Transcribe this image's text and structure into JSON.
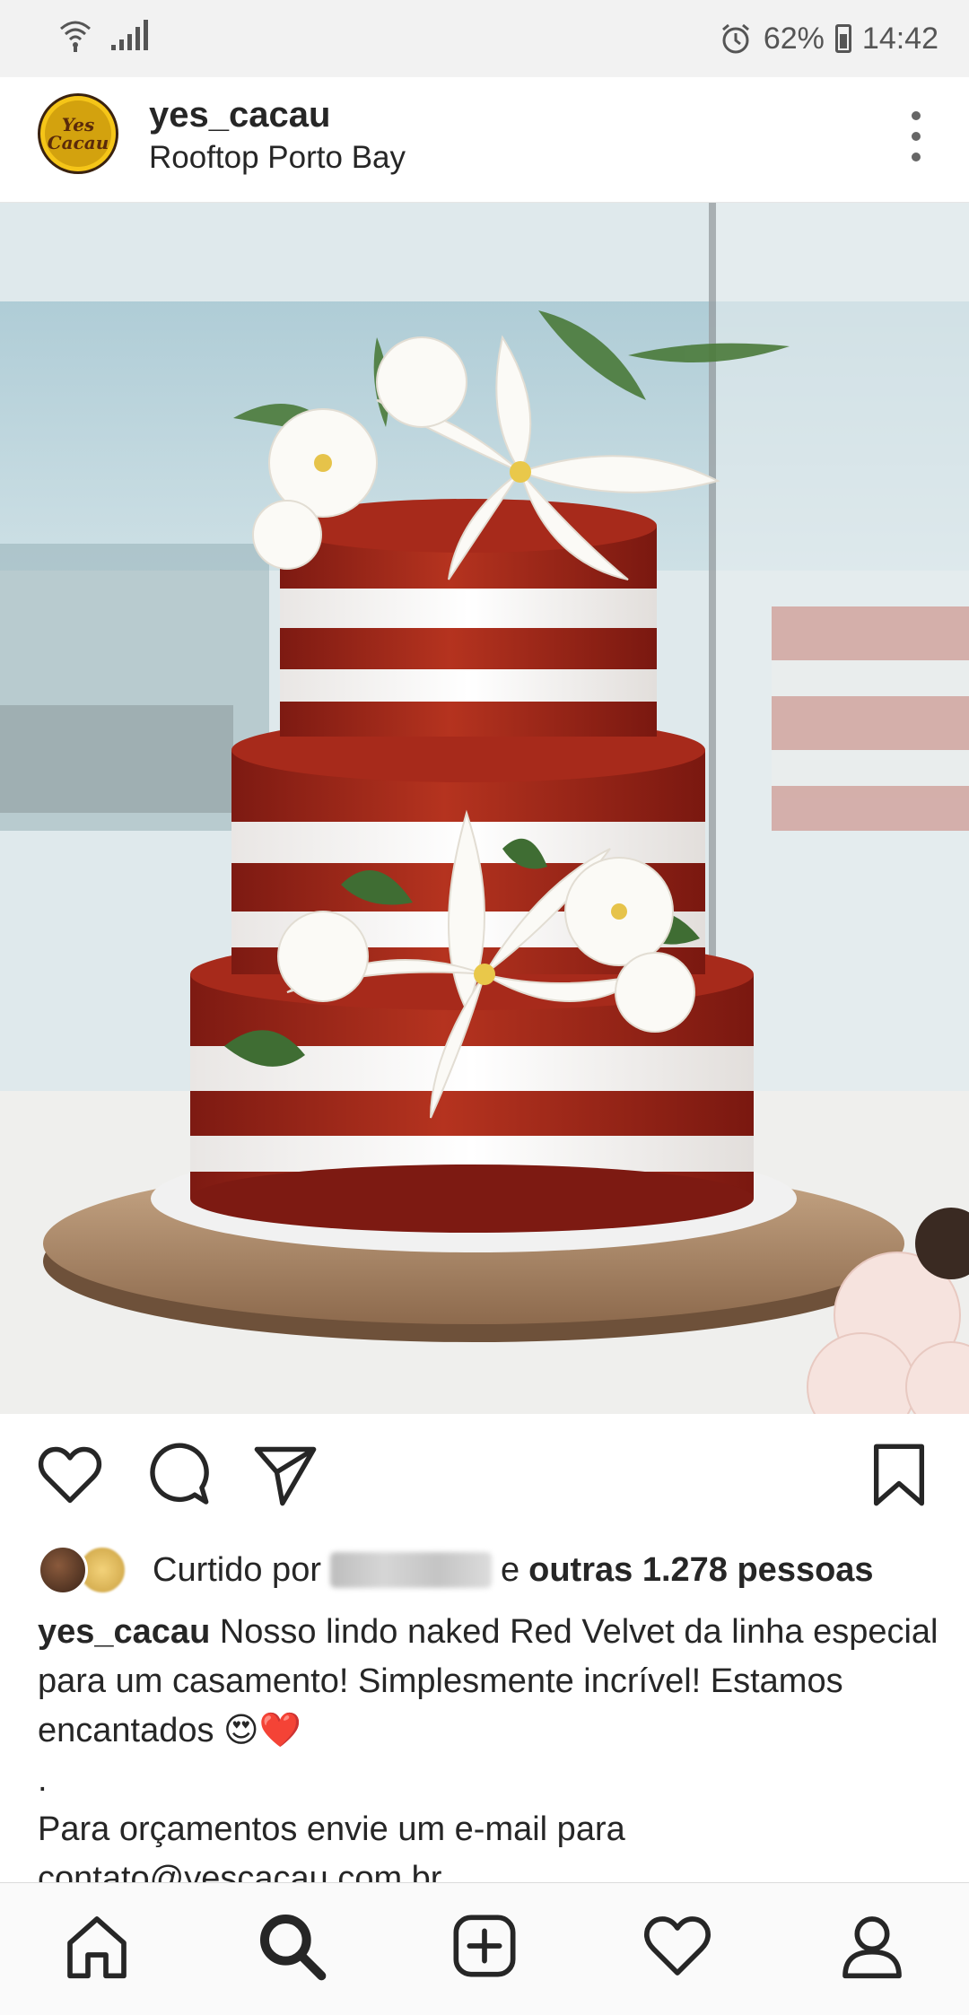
{
  "status_bar": {
    "battery": "62%",
    "time": "14:42",
    "icons": [
      "wifi-icon",
      "signal-icon",
      "alarm-icon",
      "battery-icon"
    ]
  },
  "post": {
    "avatar_text": "Yes Cacau",
    "username": "yes_cacau",
    "location": "Rooftop Porto Bay",
    "menu_icon": "more-vertical-icon"
  },
  "actions": {
    "icons": [
      "heart-icon",
      "comment-icon",
      "share-icon",
      "bookmark-icon"
    ]
  },
  "likes": {
    "prefix": "Curtido por",
    "middle": "e",
    "suffix": "outras 1.278 pessoas"
  },
  "caption": {
    "username": "yes_cacau",
    "text": "Nosso lindo naked Red Velvet da linha especial para um casamento! Simplesmente incrível! Estamos encantados 😍❤️",
    "dot": ".",
    "contact_line": "Para orçamentos envie um e-mail para",
    "email": "contato@yescacau.com.br"
  },
  "bottom_nav": {
    "icons": [
      "home-icon",
      "search-icon",
      "add-post-icon",
      "activity-heart-icon",
      "profile-icon"
    ]
  }
}
